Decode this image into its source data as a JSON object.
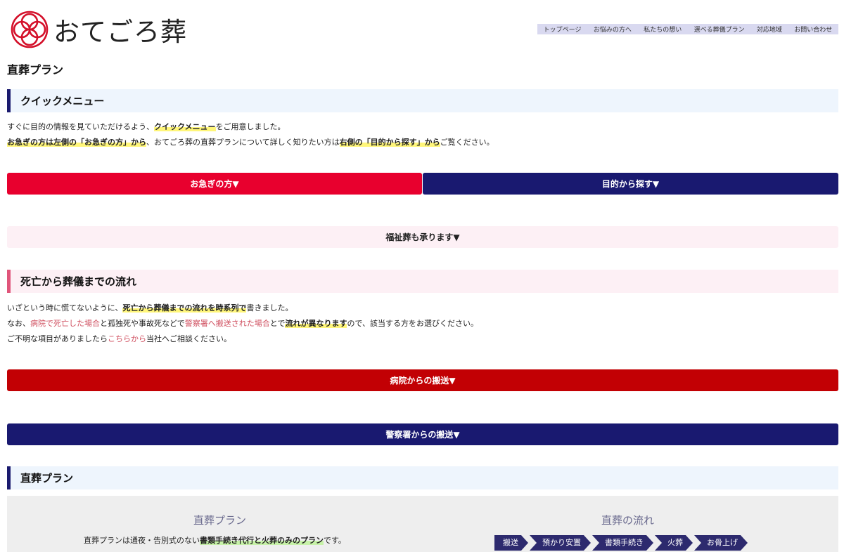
{
  "header": {
    "logo_text": "おてごろ葬",
    "nav": [
      "トップページ",
      "お悩みの方へ",
      "私たちの想い",
      "選べる葬儀プラン",
      "対応地域",
      "お問い合わせ"
    ]
  },
  "page_title": "直葬プラン",
  "quick_menu": {
    "heading": "クイックメニュー",
    "line1": {
      "pre": "すぐに目的の情報を見ていただけるよう、",
      "hl": "クイックメニュー",
      "post": "をご用意しました。"
    },
    "line2": {
      "hl1": "お急ぎの方は左側の「お急ぎの方」から",
      "mid": "、おてごろ葬の直葬プランについて詳しく知りたい方は",
      "hl2": "右側の「目的から探す」から",
      "post": "ご覧ください。"
    },
    "btn_urgent": "お急ぎの方▼",
    "btn_purpose": "目的から探す▼",
    "btn_welfare": "福祉葬も承ります▼"
  },
  "flow_section": {
    "heading": "死亡から葬儀までの流れ",
    "line1": {
      "pre": "いざという時に慌てないように、",
      "hl": "死亡から葬儀までの流れを時系列で",
      "post": "書きました。"
    },
    "line2": {
      "pre": "なお、",
      "link1": "病院で死亡した場合",
      "mid1": "と孤独死や事故死などで",
      "link2": "警察署へ搬送された場合",
      "mid2": "とで",
      "hl": "流れが異なります",
      "post": "ので、該当する方をお選びください。"
    },
    "line3": {
      "pre": "ご不明な項目がありましたら",
      "link": "こちらから",
      "post": "当社へご相談ください。"
    },
    "btn_hospital": "病院からの搬送▼",
    "btn_police": "警察署からの搬送▼"
  },
  "plan_section": {
    "heading": "直葬プラン",
    "box_title_left": "直葬プラン",
    "box_title_right": "直葬の流れ",
    "desc": {
      "pre": "直葬プランは通夜・告別式のない",
      "hl": "書類手続き代行と火葬のみのプラン",
      "post": "です。"
    },
    "flow_steps": [
      "搬送",
      "預かり安置",
      "書類手続き",
      "火葬",
      "お骨上げ"
    ]
  },
  "colors": {
    "navy": "#191970",
    "red": "#e8002e",
    "dark_red": "#c20004",
    "highlight": "#fff67a"
  }
}
